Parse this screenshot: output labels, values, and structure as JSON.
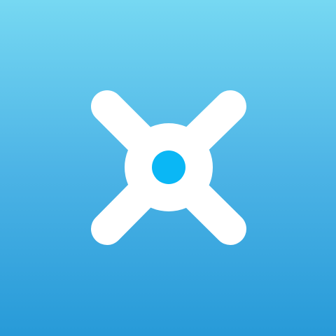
{
  "app_icon": {
    "icon": "vault-dial-icon",
    "colors": {
      "background_top": "#76d8f2",
      "background_bottom": "#279ad8",
      "glyph": "#ffffff",
      "center_dot": "#0ab7f5"
    }
  }
}
